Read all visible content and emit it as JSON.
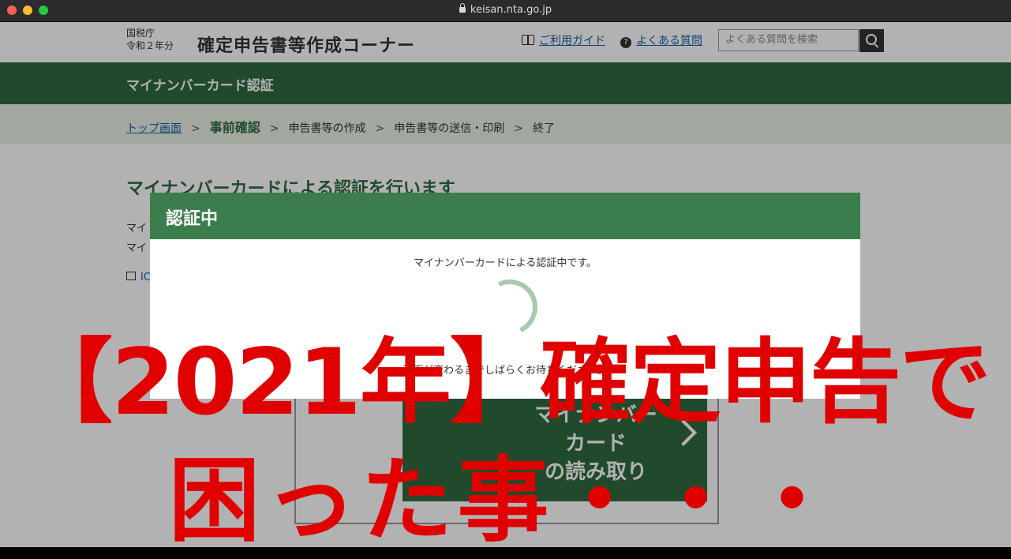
{
  "browser": {
    "url": "keisan.nta.go.jp"
  },
  "header": {
    "agency": "国税庁",
    "year": "令和２年分",
    "site_title": "確定申告書等作成コーナー",
    "guide_link": "ご利用ガイド",
    "faq_link": "よくある質問",
    "search_placeholder": "よくある質問を検索"
  },
  "section_bar": {
    "title": "マイナンバーカード認証"
  },
  "breadcrumb": {
    "top": "トップ画面",
    "current": "事前確認",
    "step3": "申告書等の作成",
    "step4": "申告書等の送信・印刷",
    "step5": "終了"
  },
  "main": {
    "heading": "マイナンバーカードによる認証を行います",
    "para1": "マイ",
    "para2": "マイ",
    "ic_link": "IC",
    "card_button": "マイナンバー\nカード\nの読み取り"
  },
  "modal": {
    "title": "認証中",
    "message": "マイナンバーカードによる認証中です。",
    "wait": "画面が変わるまでしばらくお待ちください。"
  },
  "overlay": {
    "line1": "【2021年】確定申告で",
    "line2": "困った事・・・"
  }
}
